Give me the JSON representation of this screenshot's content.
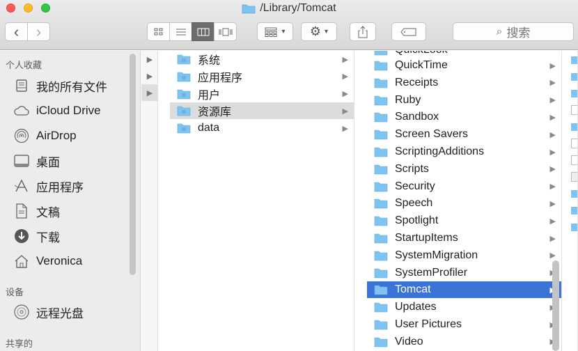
{
  "window": {
    "title": "/Library/Tomcat"
  },
  "toolbar": {
    "back_glyph": "‹",
    "forward_glyph": "›",
    "search_placeholder": "搜索",
    "search_glyph": "⌕",
    "views": [
      "icon-view",
      "list-view",
      "column-view",
      "coverflow-view"
    ],
    "active_view": "column-view"
  },
  "sidebar": {
    "favorites_header": "个人收藏",
    "favorites": [
      {
        "label": "我的所有文件",
        "icon": "all-files-icon"
      },
      {
        "label": "iCloud Drive",
        "icon": "cloud-icon"
      },
      {
        "label": "AirDrop",
        "icon": "airdrop-icon"
      },
      {
        "label": "桌面",
        "icon": "desktop-icon"
      },
      {
        "label": "应用程序",
        "icon": "applications-icon"
      },
      {
        "label": "文稿",
        "icon": "documents-icon"
      },
      {
        "label": "下载",
        "icon": "downloads-icon"
      },
      {
        "label": "Veronica",
        "icon": "home-icon"
      }
    ],
    "devices_header": "设备",
    "devices": [
      {
        "label": "远程光盘",
        "icon": "disc-icon"
      }
    ],
    "shared_header": "共享的"
  },
  "column1": {
    "items": [
      {
        "label": "系统",
        "chevron": "▶"
      },
      {
        "label": "应用程序",
        "chevron": "▶"
      },
      {
        "label": "用户",
        "chevron": "▶"
      },
      {
        "label": "资源库",
        "chevron": "▶"
      },
      {
        "label": "data",
        "chevron": "▶"
      }
    ],
    "selected": "资源库"
  },
  "column2": {
    "partial_top": "QuickLook",
    "items": [
      {
        "label": "QuickTime",
        "chevron": "▶"
      },
      {
        "label": "Receipts",
        "chevron": "▶"
      },
      {
        "label": "Ruby",
        "chevron": "▶"
      },
      {
        "label": "Sandbox",
        "chevron": "▶"
      },
      {
        "label": "Screen Savers",
        "chevron": "▶"
      },
      {
        "label": "ScriptingAdditions",
        "chevron": "▶"
      },
      {
        "label": "Scripts",
        "chevron": "▶"
      },
      {
        "label": "Security",
        "chevron": "▶"
      },
      {
        "label": "Speech",
        "chevron": "▶"
      },
      {
        "label": "Spotlight",
        "chevron": "▶"
      },
      {
        "label": "StartupItems",
        "chevron": "▶"
      },
      {
        "label": "SystemMigration",
        "chevron": "▶"
      },
      {
        "label": "SystemProfiler",
        "chevron": "▶"
      },
      {
        "label": "Tomcat",
        "chevron": "▶"
      },
      {
        "label": "Updates",
        "chevron": "▶"
      },
      {
        "label": "User Pictures",
        "chevron": "▶"
      },
      {
        "label": "Video",
        "chevron": "▶"
      }
    ],
    "selected": "Tomcat"
  },
  "colors": {
    "selection_blue": "#3a74d6",
    "folder_blue": "#7fc4f0",
    "close": "#fc5b57",
    "minimize": "#fdbc2e",
    "zoom": "#33c748"
  }
}
